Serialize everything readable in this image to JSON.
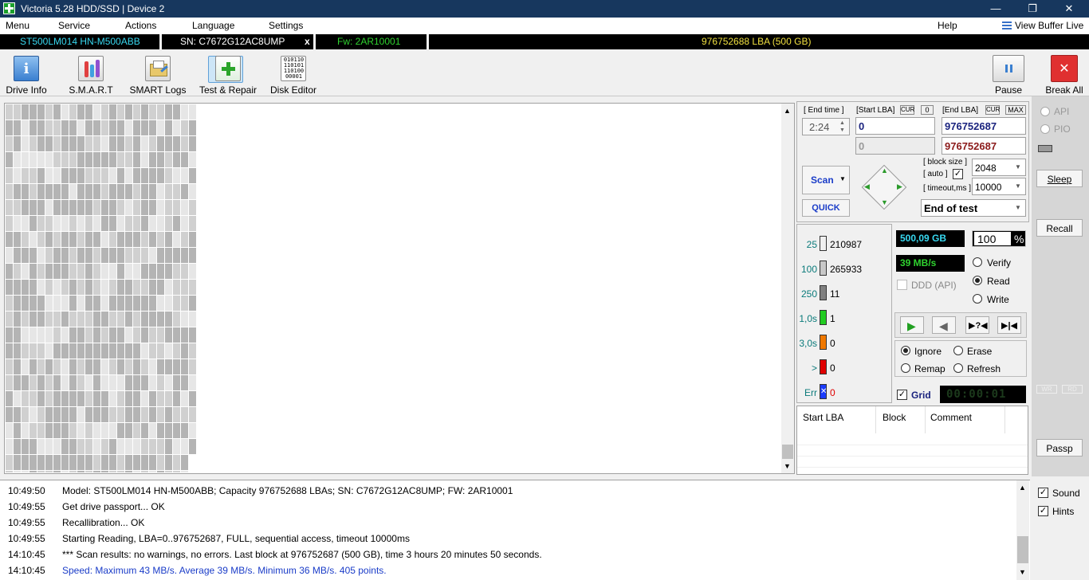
{
  "window": {
    "title": "Victoria 5.28 HDD/SSD | Device 2",
    "min": "—",
    "max": "❐",
    "close": "✕"
  },
  "menu": {
    "items": [
      "Menu",
      "Service",
      "Actions",
      "Language",
      "Settings"
    ],
    "help": "Help",
    "view_buffer": "View Buffer Live"
  },
  "drive": {
    "model": "ST500LM014 HN-M500ABB",
    "serial": "SN: C7672G12AC8UMP",
    "close": "x",
    "firmware": "Fw: 2AR10001",
    "capacity": "976752688 LBA (500 GB)"
  },
  "toolbar": {
    "left": [
      {
        "label": "Drive Info",
        "icon": "info-icon"
      },
      {
        "label": "S.M.A.R.T",
        "icon": "smart-icon"
      },
      {
        "label": "SMART Logs",
        "icon": "logs-icon"
      },
      {
        "label": "Test & Repair",
        "icon": "repair-icon"
      },
      {
        "label": "Disk Editor",
        "icon": "binary-icon"
      }
    ],
    "pause": "Pause",
    "break_all": "Break All",
    "binary_glyph": "01011011010111010000001"
  },
  "test": {
    "end_time_label": "[ End time ]",
    "end_time": "2:24",
    "start_lba_label": "[Start LBA]",
    "cur": "CUR",
    "zero": "0",
    "end_lba_label": "[End LBA]",
    "max": "MAX",
    "start_lba": "0",
    "end_lba": "976752687",
    "start_lba2": "0",
    "end_lba2": "976752687",
    "scan": "Scan",
    "quick": "QUICK",
    "block_size_label": "[ block size ]",
    "auto_label": "[ auto ]",
    "block_size": "2048",
    "timeout_label": "[ timeout,ms ]",
    "timeout": "10000",
    "end_action": "End of test"
  },
  "stats": [
    {
      "label": "25",
      "count": "210987",
      "color": "#f0f0f0",
      "label_color": "#0a7a7a"
    },
    {
      "label": "100",
      "count": "265933",
      "color": "#c8c8c8",
      "label_color": "#0a7a7a"
    },
    {
      "label": "250",
      "count": "11",
      "color": "#808080",
      "label_color": "#0a7a7a"
    },
    {
      "label": "1,0s",
      "count": "1",
      "color": "#22cc22",
      "label_color": "#0a7a7a"
    },
    {
      "label": "3,0s",
      "count": "0",
      "color": "#f07800",
      "label_color": "#0a7a7a"
    },
    {
      "label": ">",
      "count": "0",
      "color": "#e00000",
      "label_color": "#0a7a7a"
    },
    {
      "label": "Err",
      "count": "0",
      "color": "#1a3cff",
      "label_color": "#0a7a7a"
    }
  ],
  "progress": {
    "size": "500,09 GB",
    "percent": "100",
    "percent_sign": "%",
    "speed": "39 MB/s"
  },
  "mode": {
    "ddd": "DDD (API)",
    "verify": "Verify",
    "read": "Read",
    "write": "Write"
  },
  "repair": {
    "ignore": "Ignore",
    "erase": "Erase",
    "remap": "Remap",
    "refresh": "Refresh"
  },
  "grid": {
    "label": "Grid",
    "timer": "00:00:01"
  },
  "table": {
    "headers": [
      "Start LBA",
      "Block",
      "Comment"
    ]
  },
  "right": {
    "api": "API",
    "pio": "PIO",
    "sleep": "Sleep",
    "recall": "Recall",
    "wr": "WR",
    "rd": "RD",
    "passp": "Passp"
  },
  "options": {
    "sound": "Sound",
    "hints": "Hints"
  },
  "log": [
    {
      "time": "10:49:50",
      "text": "Model: ST500LM014 HN-M500ABB; Capacity 976752688 LBAs; SN: C7672G12AC8UMP; FW: 2AR10001",
      "color": "#000000"
    },
    {
      "time": "10:49:55",
      "text": "Get drive passport... OK",
      "color": "#000000"
    },
    {
      "time": "10:49:55",
      "text": "Recallibration... OK",
      "color": "#000000"
    },
    {
      "time": "10:49:55",
      "text": "Starting Reading, LBA=0..976752687, FULL, sequential access, timeout 10000ms",
      "color": "#000000"
    },
    {
      "time": "14:10:45",
      "text": "*** Scan results: no warnings, no errors. Last block at 976752687 (500 GB), time 3 hours 20 minutes 50 seconds.",
      "color": "#000000"
    },
    {
      "time": "14:10:45",
      "text": "Speed: Maximum 43 MB/s. Average 39 MB/s. Minimum 36 MB/s. 405 points.",
      "color": "#1a3cc8"
    }
  ]
}
